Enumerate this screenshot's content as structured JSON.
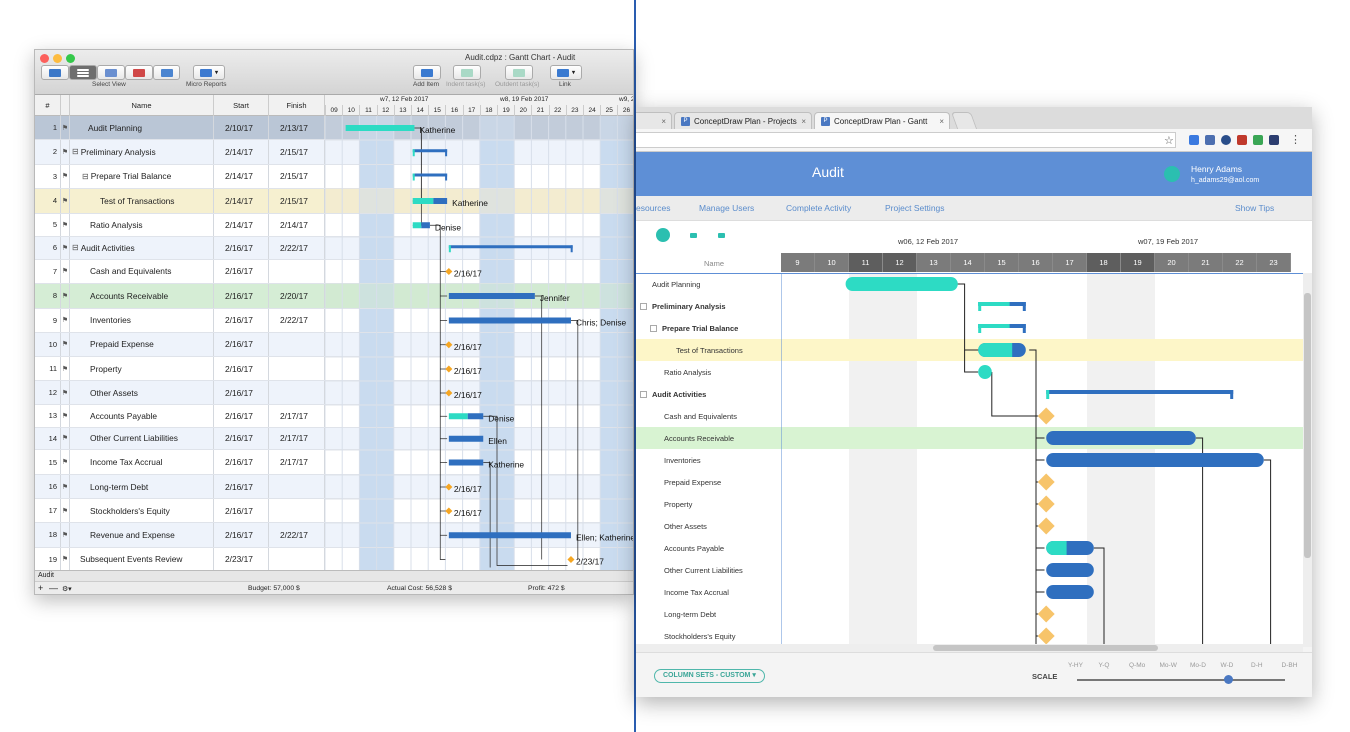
{
  "desktop": {
    "title": "Audit.cdpz : Gantt Chart - Audit",
    "toolbar": {
      "select_view": "Select View",
      "micro_reports": "Micro Reports",
      "add_item": "Add Item",
      "indent": "Indent task(s)",
      "outdent": "Outdent task(s)",
      "link": "Link"
    },
    "columns": {
      "num": "#",
      "name": "Name",
      "start": "Start",
      "finish": "Finish"
    },
    "weeks": [
      "w7, 12 Feb 2017",
      "w8, 19 Feb 2017",
      "w9, 2"
    ],
    "days": [
      "09",
      "10",
      "11",
      "12",
      "13",
      "14",
      "15",
      "16",
      "17",
      "18",
      "19",
      "20",
      "21",
      "22",
      "23",
      "24",
      "25",
      "26",
      "27"
    ],
    "rows": [
      {
        "num": "1",
        "name": "Audit Planning",
        "start": "2/10/17",
        "finish": "2/13/17",
        "label": "Katherine"
      },
      {
        "num": "2",
        "name": "Preliminary Analysis",
        "start": "2/14/17",
        "finish": "2/15/17",
        "label": ""
      },
      {
        "num": "3",
        "name": "Prepare Trial Balance",
        "start": "2/14/17",
        "finish": "2/15/17",
        "label": ""
      },
      {
        "num": "4",
        "name": "Test of Transactions",
        "start": "2/14/17",
        "finish": "2/15/17",
        "label": "Katherine"
      },
      {
        "num": "5",
        "name": "Ratio Analysis",
        "start": "2/14/17",
        "finish": "2/14/17",
        "label": "Denise"
      },
      {
        "num": "6",
        "name": "Audit Activities",
        "start": "2/16/17",
        "finish": "2/22/17",
        "label": ""
      },
      {
        "num": "7",
        "name": "Cash and Equivalents",
        "start": "2/16/17",
        "finish": "",
        "label": "2/16/17"
      },
      {
        "num": "8",
        "name": "Accounts Receivable",
        "start": "2/16/17",
        "finish": "2/20/17",
        "label": "Jennifer"
      },
      {
        "num": "9",
        "name": "Inventories",
        "start": "2/16/17",
        "finish": "2/22/17",
        "label": "Chris; Denise"
      },
      {
        "num": "10",
        "name": "Prepaid Expense",
        "start": "2/16/17",
        "finish": "",
        "label": "2/16/17"
      },
      {
        "num": "11",
        "name": "Property",
        "start": "2/16/17",
        "finish": "",
        "label": "2/16/17"
      },
      {
        "num": "12",
        "name": "Other Assets",
        "start": "2/16/17",
        "finish": "",
        "label": "2/16/17"
      },
      {
        "num": "13",
        "name": "Accounts Payable",
        "start": "2/16/17",
        "finish": "2/17/17",
        "label": "Denise"
      },
      {
        "num": "14",
        "name": "Other Current Liabilities",
        "start": "2/16/17",
        "finish": "2/17/17",
        "label": "Ellen"
      },
      {
        "num": "15",
        "name": "Income Tax  Accrual",
        "start": "2/16/17",
        "finish": "2/17/17",
        "label": "Katherine"
      },
      {
        "num": "16",
        "name": "Long-term Debt",
        "start": "2/16/17",
        "finish": "",
        "label": "2/16/17"
      },
      {
        "num": "17",
        "name": "Stockholders's Equity",
        "start": "2/16/17",
        "finish": "",
        "label": "2/16/17"
      },
      {
        "num": "18",
        "name": "Revenue and Expense",
        "start": "2/16/17",
        "finish": "2/22/17",
        "label": "Ellen; Katherine"
      },
      {
        "num": "19",
        "name": "Subsequent Events Review",
        "start": "2/23/17",
        "finish": "",
        "label": "2/23/17"
      }
    ],
    "sheet_tab": "Audit",
    "budget": "Budget: 57,000 $",
    "actual_cost": "Actual Cost: 56,528 $",
    "profit": "Profit: 472 $"
  },
  "browser": {
    "tabs": [
      {
        "label": "ConceptDraw Plan - Projects"
      },
      {
        "label": "ConceptDraw Plan - Gantt - Au"
      }
    ],
    "app_title": "Audit",
    "user": {
      "initial": "",
      "name": "Henry Adams",
      "email": "h_adams29@aol.com"
    },
    "nav": [
      "esources",
      "Manage Users",
      "Complete Activity",
      "Project Settings"
    ],
    "show_tips": "Show Tips",
    "name_header": "Name",
    "weeks": [
      "w06, 12 Feb 2017",
      "w07, 19 Feb 2017"
    ],
    "days": [
      "9",
      "10",
      "11",
      "12",
      "13",
      "14",
      "15",
      "16",
      "17",
      "18",
      "19",
      "20",
      "21",
      "22",
      "23"
    ],
    "rows": [
      {
        "name": "Audit Planning",
        "bold": false,
        "indent": 1,
        "expander": false
      },
      {
        "name": "Preliminary Analysis",
        "bold": true,
        "indent": 1,
        "expander": true
      },
      {
        "name": "Prepare Trial Balance",
        "bold": true,
        "indent": 2,
        "expander": true
      },
      {
        "name": "Test of Transactions",
        "bold": false,
        "indent": 3,
        "expander": false
      },
      {
        "name": "Ratio Analysis",
        "bold": false,
        "indent": 2,
        "expander": false
      },
      {
        "name": "Audit Activities",
        "bold": true,
        "indent": 1,
        "expander": true
      },
      {
        "name": "Cash and Equivalents",
        "bold": false,
        "indent": 2,
        "expander": false
      },
      {
        "name": "Accounts Receivable",
        "bold": false,
        "indent": 2,
        "expander": false
      },
      {
        "name": "Inventories",
        "bold": false,
        "indent": 2,
        "expander": false
      },
      {
        "name": "Prepaid Expense",
        "bold": false,
        "indent": 2,
        "expander": false
      },
      {
        "name": "Property",
        "bold": false,
        "indent": 2,
        "expander": false
      },
      {
        "name": "Other Assets",
        "bold": false,
        "indent": 2,
        "expander": false
      },
      {
        "name": "Accounts Payable",
        "bold": false,
        "indent": 2,
        "expander": false
      },
      {
        "name": "Other Current Liabilities",
        "bold": false,
        "indent": 2,
        "expander": false
      },
      {
        "name": "Income Tax Accrual",
        "bold": false,
        "indent": 2,
        "expander": false
      },
      {
        "name": "Long-term Debt",
        "bold": false,
        "indent": 2,
        "expander": false
      },
      {
        "name": "Stockholders's Equity",
        "bold": false,
        "indent": 2,
        "expander": false
      }
    ],
    "column_sets": "COLUMN SETS - CUSTOM ▾",
    "scale_label": "SCALE",
    "scale_options": [
      "Y-HY",
      "Y-Q",
      "Q-Mo",
      "Mo-W",
      "Mo-D",
      "W-D",
      "D-H",
      "D-BH"
    ],
    "scale_selected": "W-D"
  },
  "colors": {
    "teal": "#2ddbc4",
    "blue": "#2f6fbf",
    "milestone": "#f7c46a",
    "highlight_yellow": "#fdf6c8",
    "highlight_green": "#d6f5d0",
    "header_blue": "#5e8fd6"
  }
}
